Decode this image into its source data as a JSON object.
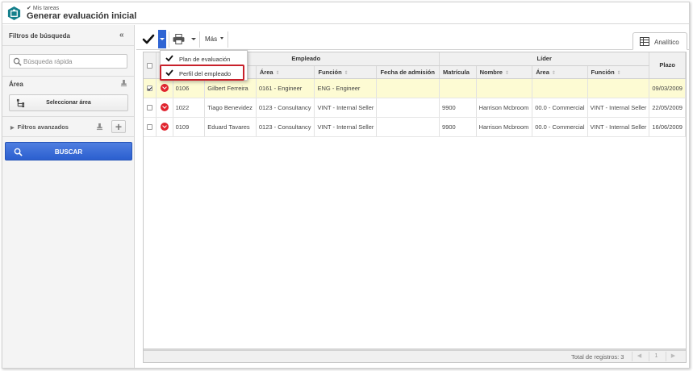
{
  "header": {
    "breadcrumb": "Mis tareas",
    "title": "Generar evaluación inicial"
  },
  "sidebar": {
    "title": "Filtros de búsqueda",
    "search_placeholder": "Búsqueda rápida",
    "area_label": "Área",
    "select_area_label": "Seleccionar área",
    "advanced_filters_label": "Filtros avanzados",
    "search_button_label": "BUSCAR"
  },
  "toolbar": {
    "more_label": "Más",
    "view_tab_label": "Analítico",
    "accent_color": "#2f65d4"
  },
  "dropdown": {
    "items": [
      {
        "label": "Plan de evaluación"
      },
      {
        "label": "Perfil del empleado"
      }
    ],
    "highlight_color": "#c8202a"
  },
  "grid": {
    "group_headers": {
      "employee": "Empleado",
      "leader": "Líder",
      "deadline": "Plazo"
    },
    "columns": {
      "area": "Área",
      "function": "Función",
      "admission": "Fecha de admisión",
      "matricula": "Matrícula",
      "name": "Nombre",
      "leader_area": "Área",
      "leader_function": "Función"
    },
    "rows": [
      {
        "selected": true,
        "id": "0106",
        "name": "Gilbert Ferreira",
        "area": "0161 - Engineer",
        "function": "ENG - Engineer",
        "admission": "",
        "leader_matricula": "",
        "leader_name": "",
        "leader_area": "",
        "leader_function": "",
        "deadline": "09/03/2009"
      },
      {
        "selected": false,
        "id": "1022",
        "name": "Tiago Benevidez",
        "area": "0123 - Consultancy",
        "function": "VINT - Internal Seller",
        "admission": "",
        "leader_matricula": "9900",
        "leader_name": "Harrison Mcbroom",
        "leader_area": "00.0 - Commercial",
        "leader_function": "VINT - Internal Seller",
        "deadline": "22/05/2009"
      },
      {
        "selected": false,
        "id": "0109",
        "name": "Eduard Tavares",
        "area": "0123 - Consultancy",
        "function": "VINT - Internal Seller",
        "admission": "",
        "leader_matricula": "9900",
        "leader_name": "Harrison Mcbroom",
        "leader_area": "00.0 - Commercial",
        "leader_function": "VINT - Internal Seller",
        "deadline": "16/06/2009"
      }
    ],
    "status_color": "#e0242e",
    "selected_row_color": "#fdfbd3",
    "total_label": "Total de registros: 3",
    "page_number": "1"
  }
}
